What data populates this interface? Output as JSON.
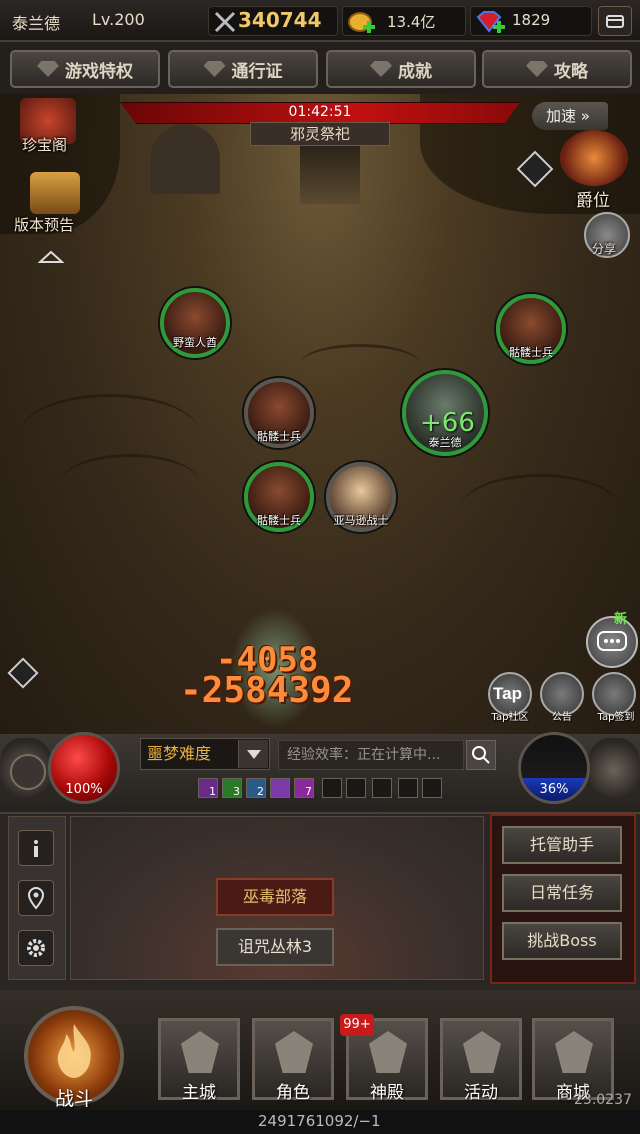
{
  "topbar": {
    "player_name": "泰兰德",
    "level": "Lv.200",
    "power": "340744",
    "gold": "13.4亿",
    "gems": "1829"
  },
  "nav": {
    "privileges": "游戏特权",
    "pass": "通行证",
    "achievements": "成就",
    "guide": "攻略"
  },
  "scene": {
    "timer": "01:42:51",
    "boss_name": "邪灵祭祀",
    "speedup": "加速",
    "treasure": "珍宝阁",
    "preview": "版本预告",
    "rank": "爵位",
    "share": "分享",
    "heal": "+66",
    "damage_1": "-4058",
    "damage_2": "-2584392",
    "new_badge": "新",
    "tap_logo": "Tap",
    "tap_community": "Tap社区",
    "notice": "公告",
    "tap_signin": "Tap签到"
  },
  "units": {
    "u1": "野蛮人酋",
    "u2": "骷髅士兵",
    "u3": "骷髅士兵",
    "player": "泰兰德",
    "u5": "骷髅士兵",
    "u6": "亚马逊战士"
  },
  "controls": {
    "hp": "100%",
    "mp": "36%",
    "difficulty": "噩梦难度",
    "exp_placeholder": "经验效率：正在计算中...",
    "buffs": [
      "1",
      "3",
      "2",
      "",
      "7"
    ]
  },
  "panel": {
    "zone_current": "巫毒部落",
    "zone_next": "诅咒丛林3",
    "auto_assist": "托管助手",
    "daily_tasks": "日常任务",
    "boss_challenge": "挑战Boss"
  },
  "bottom": {
    "battle": "战斗",
    "city": "主城",
    "character": "角色",
    "temple": "神殿",
    "temple_badge": "99+",
    "events": "活动",
    "shop": "商城",
    "footer_id": "2491761092/−1",
    "version": "23.0237"
  },
  "colors": {
    "hp": "#c81010",
    "mp": "#1a3ab8",
    "damage": "#ff8a3a",
    "heal": "#7ae86a",
    "ally_ring": "#2f9a3a"
  }
}
